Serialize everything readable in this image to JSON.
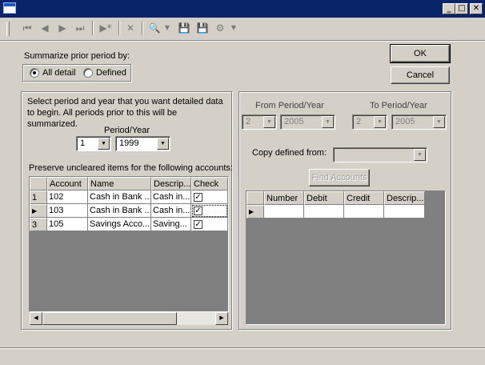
{
  "toolbar": {
    "icons": [
      "first-record-icon",
      "previous-record-icon",
      "next-record-icon",
      "last-record-icon",
      "new-record-icon",
      "delete-icon",
      "search-icon",
      "save-icon",
      "save-close-icon",
      "setup-icon"
    ]
  },
  "buttons": {
    "ok": "OK",
    "cancel": "Cancel",
    "find_accounts": "Find Accounts"
  },
  "summarize": {
    "label": "Summarize prior period by:",
    "option_all": "All detail",
    "option_defined": "Defined",
    "selected": "All detail"
  },
  "left_panel": {
    "instruction": "Select period and year that you want detailed data to begin. All periods prior to this will be summarized.",
    "period_year_label": "Period/Year",
    "period": "1",
    "year": "1999",
    "preserve_label": "Preserve uncleared items for the following accounts:",
    "grid": {
      "headers": [
        "Account",
        "Name",
        "Descrip...",
        "Check"
      ],
      "rows": [
        {
          "indicator": "1",
          "account": "102",
          "name": "Cash in Bank ...",
          "description": "Cash in...",
          "checked": true
        },
        {
          "indicator": "▶",
          "account": "103",
          "name": "Cash in Bank ...",
          "description": "Cash in...",
          "checked": true
        },
        {
          "indicator": "3",
          "account": "105",
          "name": "Savings Acco...",
          "description": "Saving...",
          "checked": true
        }
      ]
    }
  },
  "right_panel": {
    "from_label": "From Period/Year",
    "to_label": "To Period/Year",
    "from_period": "2",
    "from_year": "2005",
    "to_period": "2",
    "to_year": "2005",
    "copy_label": "Copy defined from:",
    "copy_value": "",
    "grid": {
      "headers": [
        "Number",
        "Debit",
        "Credit",
        "Descrip..."
      ],
      "rows": [
        {
          "indicator": "▶",
          "number": "",
          "debit": "",
          "credit": "",
          "description": ""
        }
      ]
    }
  },
  "colors": {
    "title_bar": "#0a246a",
    "face": "#d4d0c8",
    "grid_background": "#808080"
  }
}
